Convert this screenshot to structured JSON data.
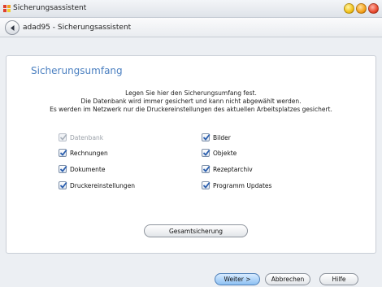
{
  "window": {
    "title": "Sicherungsassistent"
  },
  "nav": {
    "title": "adad95 - Sicherungsassistent"
  },
  "content": {
    "heading": "Sicherungsumfang",
    "intro_lines": [
      "Legen Sie hier den Sicherungsumfang fest.",
      "Die Datenbank wird immer gesichert und kann nicht abgewählt werden.",
      "Es werden im Netzwerk nur die  Druckereinstellungen des aktuellen Arbeitsplatzes gesichert."
    ],
    "options": [
      {
        "label": "Datenbank",
        "checked": true,
        "enabled": false
      },
      {
        "label": "Bilder",
        "checked": true,
        "enabled": true
      },
      {
        "label": "Rechnungen",
        "checked": true,
        "enabled": true
      },
      {
        "label": "Objekte",
        "checked": true,
        "enabled": true
      },
      {
        "label": "Dokumente",
        "checked": true,
        "enabled": true
      },
      {
        "label": "Rezeptarchiv",
        "checked": true,
        "enabled": true
      },
      {
        "label": "Druckereinstellungen",
        "checked": true,
        "enabled": true
      },
      {
        "label": "Programm Updates",
        "checked": true,
        "enabled": true
      }
    ],
    "full_backup_label": "Gesamtsicherung"
  },
  "buttons": {
    "next": "Weiter >",
    "cancel": "Abbrechen",
    "help": "Hilfe"
  },
  "colors": {
    "heading": "#4a7fc0",
    "checkmark": "#2b5fae",
    "next_button": "#8ec1f3"
  },
  "icons": {
    "back": "back-arrow-icon",
    "check": "checkmark-icon"
  }
}
